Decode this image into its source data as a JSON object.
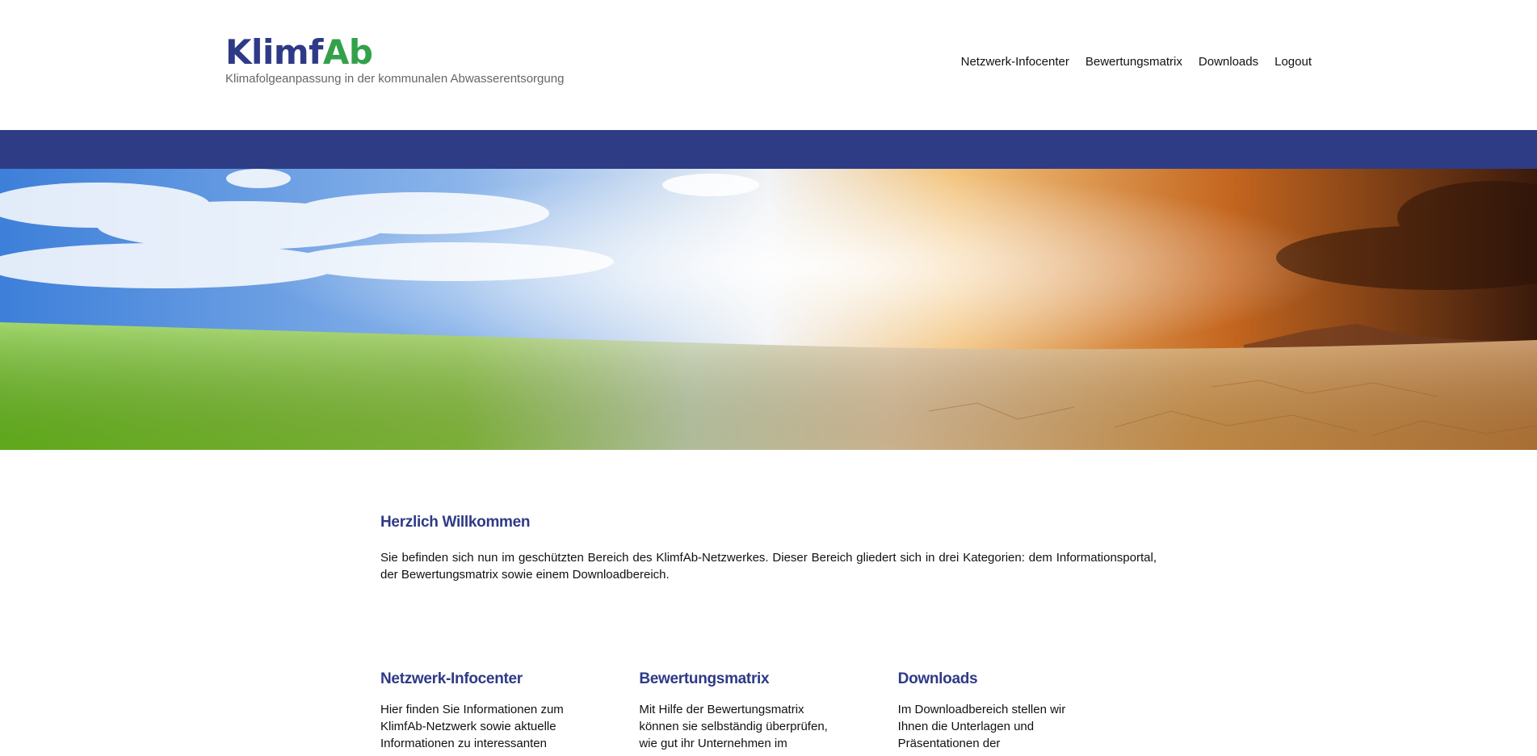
{
  "brand": {
    "logo_part1": "Klimf",
    "logo_part2": "Ab",
    "tagline": "Klimafolgeanpassung in der kommunalen Abwasserentsorgung",
    "colors": {
      "primary": "#2e3a87",
      "accent": "#33a14a",
      "band": "#2e3c86"
    }
  },
  "nav": {
    "items": [
      {
        "label": "Netzwerk-Infocenter"
      },
      {
        "label": "Bewertungsmatrix"
      },
      {
        "label": "Downloads"
      },
      {
        "label": "Logout"
      }
    ]
  },
  "intro": {
    "title": "Herzlich Willkommen",
    "text": "Sie befinden sich nun im geschützten Bereich des KlimfAb-Netzwerkes. Dieser Bereich gliedert sich in drei Kategorien: dem Informationsportal, der Bewertungsmatrix sowie einem Downloadbereich."
  },
  "columns": [
    {
      "title": "Netzwerk-Infocenter",
      "text": "Hier finden Sie Informationen zum KlimfAb-Netzwerk sowie aktuelle Informationen zu interessanten"
    },
    {
      "title": "Bewertungsmatrix",
      "text": "Mit Hilfe der Bewertungsmatrix können sie selbständig überprüfen, wie gut ihr Unternehmen im"
    },
    {
      "title": "Downloads",
      "text": "Im Downloadbereich stellen wir Ihnen die Unterlagen und Präsentationen der"
    }
  ]
}
